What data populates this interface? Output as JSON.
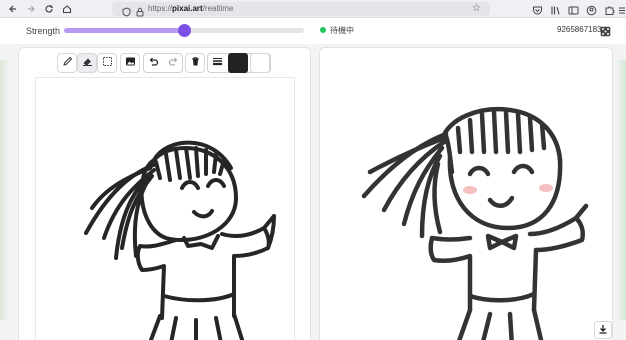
{
  "browser": {
    "url_prefix": "https://",
    "url_domain": "pixai.art",
    "url_path": "/realtime"
  },
  "header": {
    "strength_label": "Strength",
    "strength_value": 0.5,
    "status_text": "待機中",
    "status_color": "#22c55e",
    "seed": "9265867183"
  },
  "toolbar": {
    "tools": [
      {
        "name": "pencil-tool",
        "icon": "pencil-icon"
      },
      {
        "name": "eraser-tool",
        "icon": "eraser-icon"
      },
      {
        "name": "select-tool",
        "icon": "dashed-select-icon"
      },
      {
        "name": "image-tool",
        "icon": "image-icon"
      },
      {
        "name": "undo-button",
        "icon": "undo-icon"
      },
      {
        "name": "redo-button",
        "icon": "redo-icon"
      },
      {
        "name": "delete-button",
        "icon": "trash-icon"
      },
      {
        "name": "stroke-width-button",
        "icon": "lines-icon"
      }
    ],
    "colors": [
      "#222222",
      "#ffffff"
    ]
  },
  "accent": "#7e4fe6"
}
